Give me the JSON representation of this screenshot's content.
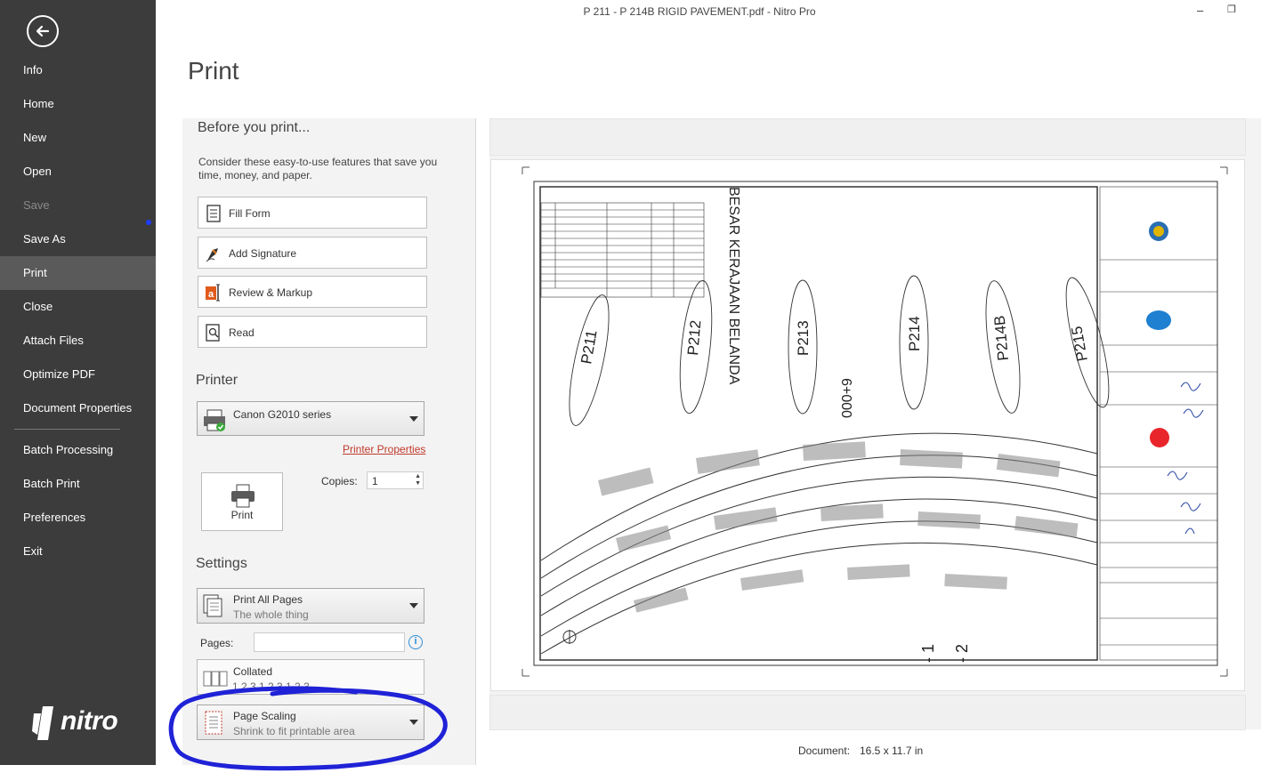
{
  "window": {
    "title": "P 211 - P 214B RIGID PAVEMENT.pdf - Nitro Pro",
    "minimize": "–",
    "restore": "❐"
  },
  "sidebar": {
    "items": [
      {
        "label": "Info"
      },
      {
        "label": "Home"
      },
      {
        "label": "New"
      },
      {
        "label": "Open"
      },
      {
        "label": "Save"
      },
      {
        "label": "Save As"
      },
      {
        "label": "Print"
      },
      {
        "label": "Close"
      },
      {
        "label": "Attach Files"
      },
      {
        "label": "Optimize PDF"
      },
      {
        "label": "Document Properties"
      },
      {
        "label": "Batch Processing"
      },
      {
        "label": "Batch Print"
      },
      {
        "label": "Preferences"
      },
      {
        "label": "Exit"
      }
    ],
    "logo": "nitro"
  },
  "main": {
    "title": "Print",
    "before": {
      "heading": "Before you print...",
      "description": "Consider these easy-to-use features that save you time, money, and paper.",
      "buttons": [
        {
          "label": "Fill Form",
          "icon": "form-icon"
        },
        {
          "label": "Add Signature",
          "icon": "signature-pen-icon"
        },
        {
          "label": "Review & Markup",
          "icon": "markup-icon"
        },
        {
          "label": "Read",
          "icon": "read-icon"
        }
      ]
    },
    "printer": {
      "heading": "Printer",
      "selected": "Canon G2010 series",
      "properties_link": "Printer Properties",
      "print_button": "Print",
      "copies_label": "Copies:",
      "copies_value": "1"
    },
    "settings": {
      "heading": "Settings",
      "range": {
        "title": "Print All Pages",
        "subtitle": "The whole thing"
      },
      "pages_label": "Pages:",
      "pages_value": "",
      "collated": {
        "title": "Collated",
        "subtitle": "1,2,3   1,2,3   1,2,3"
      },
      "scaling": {
        "title": "Page Scaling",
        "subtitle": "Shrink to fit printable area"
      }
    },
    "document": {
      "label": "Document:",
      "value": "16.5 x 11.7 in"
    }
  },
  "colors": {
    "sidebar": "#3c3c3c",
    "sidebar_active": "#5a5a5a",
    "link": "#c0392b",
    "annotation": "#1f22d6"
  }
}
